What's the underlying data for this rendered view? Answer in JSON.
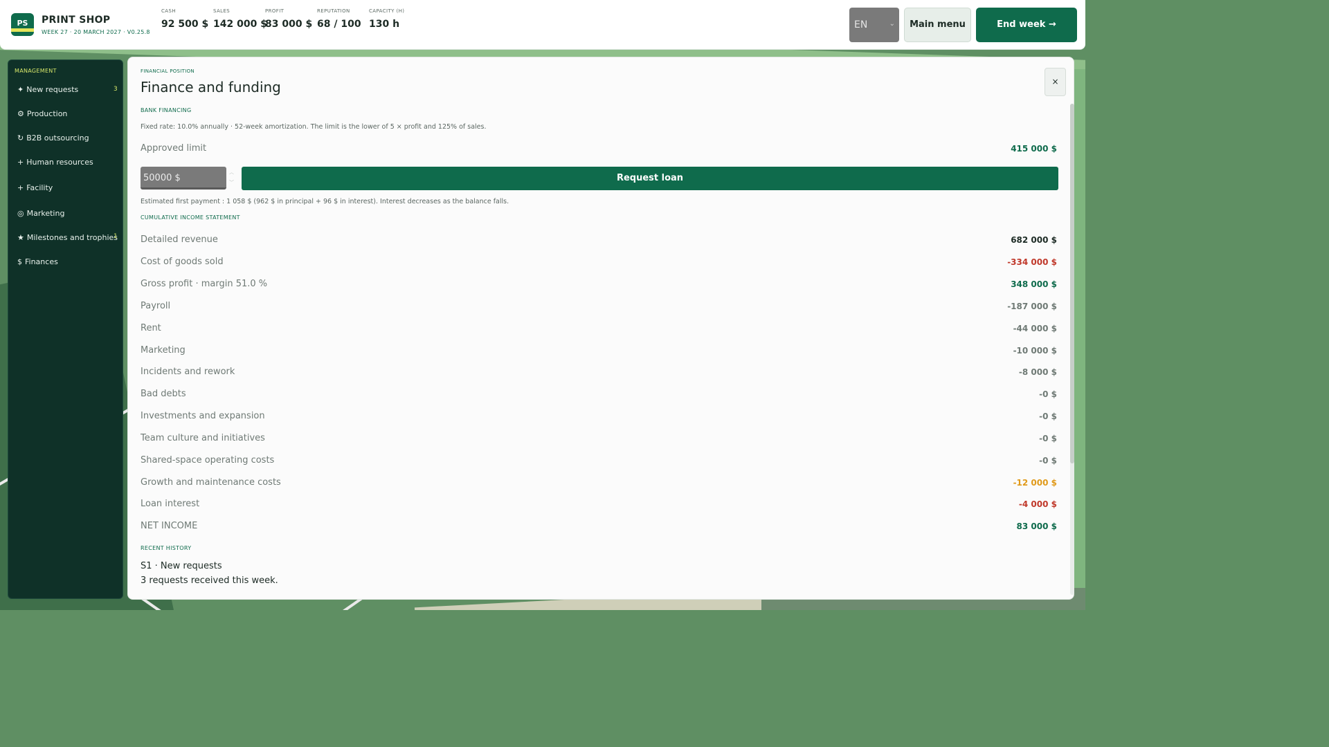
{
  "app": {
    "logo_text": "PS",
    "title": "PRINT SHOP",
    "subtitle": "WEEK 27 · 20 MARCH 2027 · V0.25.8"
  },
  "stats": [
    {
      "label": "CASH",
      "value": "92 500 $"
    },
    {
      "label": "SALES",
      "value": "142 000 $"
    },
    {
      "label": "PROFIT",
      "value": "83 000 $"
    },
    {
      "label": "REPUTATION",
      "value": "68 / 100"
    },
    {
      "label": "CAPACITY (H)",
      "value": "130 h"
    }
  ],
  "header": {
    "language": "EN",
    "main_menu": "Main menu",
    "end_week": "End week →"
  },
  "sidebar": {
    "heading": "MANAGEMENT",
    "items": [
      {
        "icon": "✦",
        "label": "New requests",
        "badge": "3"
      },
      {
        "icon": "⚙",
        "label": "Production",
        "badge": ""
      },
      {
        "icon": "↻",
        "label": "B2B outsourcing",
        "badge": ""
      },
      {
        "icon": "+",
        "label": "Human resources",
        "badge": ""
      },
      {
        "icon": "+",
        "label": "Facility",
        "badge": ""
      },
      {
        "icon": "◎",
        "label": "Marketing",
        "badge": ""
      },
      {
        "icon": "★",
        "label": "Milestones and trophies",
        "badge": "1"
      },
      {
        "icon": "$",
        "label": "Finances",
        "badge": ""
      }
    ]
  },
  "panel": {
    "eyebrow": "FINANCIAL POSITION",
    "title": "Finance and funding",
    "close": "×",
    "bank_heading": "BANK FINANCING",
    "bank_note": "Fixed rate: 10.0% annually · 52-week amortization. The limit is the lower of 5 × profit and 125% of sales.",
    "approved_label": "Approved limit",
    "approved_value": "415 000 $",
    "loan_amount": "50000  $",
    "request_loan": "Request loan",
    "payment_note": "Estimated first payment : 1 058 $ (962 $ in principal + 96 $ in interest). Interest decreases as the balance falls.",
    "income_heading": "CUMULATIVE INCOME STATEMENT",
    "income_rows": [
      {
        "label": "Detailed revenue",
        "value": "682 000 $",
        "tone": "dark"
      },
      {
        "label": "Cost of goods sold",
        "value": "-334 000 $",
        "tone": "neg"
      },
      {
        "label": "Gross profit · margin 51.0 %",
        "value": "348 000 $",
        "tone": "pos"
      },
      {
        "label": "Payroll",
        "value": "-187 000 $",
        "tone": "neu"
      },
      {
        "label": "Rent",
        "value": "-44 000 $",
        "tone": "neu"
      },
      {
        "label": "Marketing",
        "value": "-10 000 $",
        "tone": "neu"
      },
      {
        "label": "Incidents and rework",
        "value": "-8 000 $",
        "tone": "neu"
      },
      {
        "label": "Bad debts",
        "value": "-0 $",
        "tone": "neu"
      },
      {
        "label": "Investments and expansion",
        "value": "-0 $",
        "tone": "neu"
      },
      {
        "label": "Team culture and initiatives",
        "value": "-0 $",
        "tone": "neu"
      },
      {
        "label": "Shared-space operating costs",
        "value": "-0 $",
        "tone": "neu"
      },
      {
        "label": "Growth and maintenance costs",
        "value": "-12 000 $",
        "tone": "warn"
      },
      {
        "label": "Loan interest",
        "value": "-4 000 $",
        "tone": "neg"
      },
      {
        "label": "NET INCOME",
        "value": "83 000 $",
        "tone": "pos"
      }
    ],
    "history_heading": "RECENT HISTORY",
    "history_title": "S1 · New requests",
    "history_desc": "3 requests received this week."
  },
  "colors": {
    "brand": "#0f6b4c",
    "accent": "#d8e86a",
    "negative": "#c0392b",
    "warning": "#e09a1a"
  }
}
